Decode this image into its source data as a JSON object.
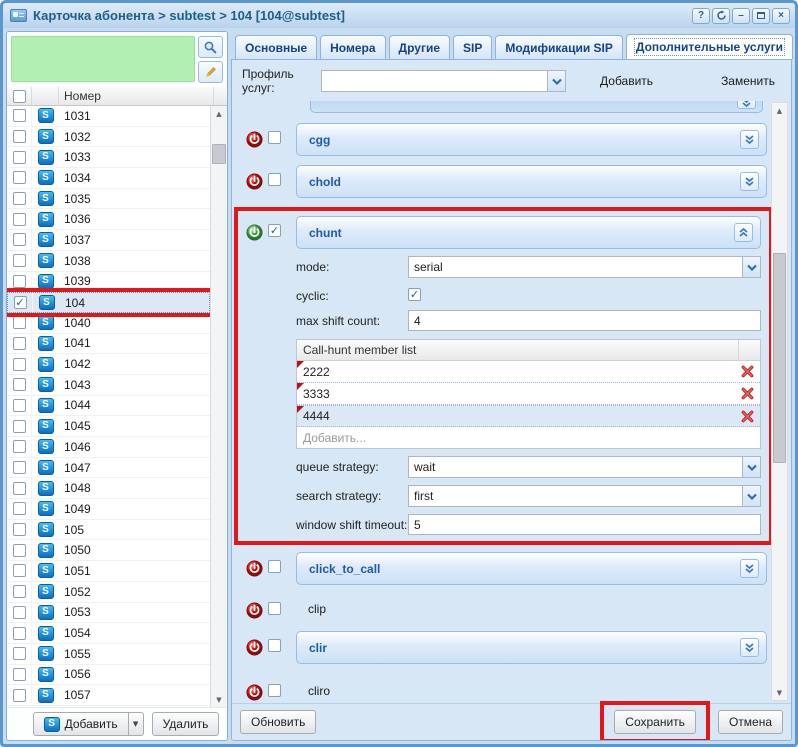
{
  "window": {
    "title": "Карточка абонента > subtest > 104 [104@subtest]",
    "controls": {
      "help": "?",
      "refresh": "refresh",
      "minimize": "–",
      "maximize": "max",
      "close": "×"
    }
  },
  "left_panel": {
    "search_value": "",
    "column_header": "Номер",
    "numbers": [
      "1031",
      "1032",
      "1033",
      "1034",
      "1035",
      "1036",
      "1037",
      "1038",
      "1039",
      "104",
      "1040",
      "1041",
      "1042",
      "1043",
      "1044",
      "1045",
      "1046",
      "1047",
      "1048",
      "1049",
      "105",
      "1050",
      "1051",
      "1052",
      "1053",
      "1054",
      "1055",
      "1056",
      "1057"
    ],
    "selected_number": "104",
    "add_button": "Добавить",
    "delete_button": "Удалить"
  },
  "tabs": {
    "items": [
      "Основные",
      "Номера",
      "Другие",
      "SIP",
      "Модификации SIP",
      "Дополнительные услуги"
    ],
    "active": "Дополнительные услуги"
  },
  "profile": {
    "label": "Профиль услуг:",
    "value": "",
    "add_button": "Добавить",
    "replace_button": "Заменить"
  },
  "services": [
    {
      "name": "cgg",
      "style": "panel",
      "power": "off",
      "checked": false
    },
    {
      "name": "chold",
      "style": "panel",
      "power": "off",
      "checked": false
    },
    {
      "name": "chunt",
      "style": "expanded",
      "power": "on",
      "checked": true
    },
    {
      "name": "click_to_call",
      "style": "panel",
      "power": "off",
      "checked": false
    },
    {
      "name": "clip",
      "style": "plain",
      "power": "off",
      "checked": false
    },
    {
      "name": "clir",
      "style": "panel",
      "power": "off",
      "checked": false
    },
    {
      "name": "cliro",
      "style": "plain",
      "power": "off",
      "checked": false
    }
  ],
  "chunt_form": {
    "mode": {
      "label": "mode:",
      "value": "serial"
    },
    "cyclic": {
      "label": "cyclic:",
      "checked": true
    },
    "max_shift_count": {
      "label": "max shift count:",
      "value": "4"
    },
    "member_list": {
      "header": "Call-hunt member list",
      "members": [
        "2222",
        "3333",
        "4444"
      ],
      "selected": "4444",
      "add_placeholder": "Добавить..."
    },
    "queue_strategy": {
      "label": "queue strategy:",
      "value": "wait"
    },
    "search_strategy": {
      "label": "search strategy:",
      "value": "first"
    },
    "window_shift_timeout": {
      "label": "window shift timeout:",
      "value": "5"
    }
  },
  "footer": {
    "refresh_button": "Обновить",
    "save_button": "Сохранить",
    "cancel_button": "Отмена"
  },
  "colors": {
    "annotation": "#e31717",
    "accent_blue": "#1d5bab",
    "panel_border": "#99bbe8",
    "power_off": "#cc1111",
    "power_on": "#49a949",
    "search_box_green": "#b2efb2"
  }
}
